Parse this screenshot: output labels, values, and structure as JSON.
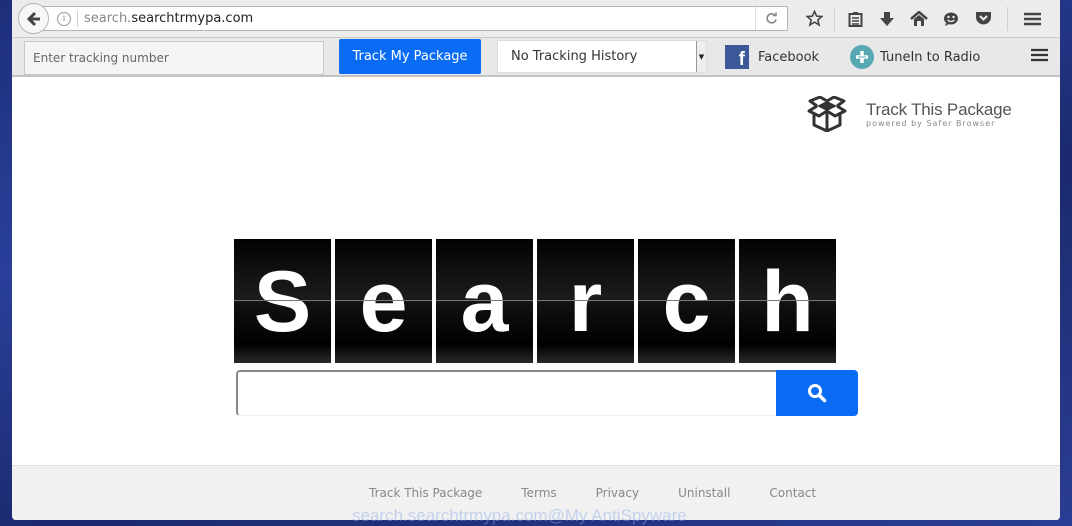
{
  "browser": {
    "url_prefix": "search.",
    "url_domain": "searchtrmypa.com",
    "icons": [
      "star-icon",
      "reading-list-icon",
      "download-icon",
      "home-icon",
      "hello-icon",
      "pocket-icon",
      "menu-icon"
    ]
  },
  "toolbar": {
    "tracking_placeholder": "Enter tracking number",
    "track_button": "Track My Package",
    "history_selected": "No Tracking History",
    "facebook_label": "Facebook",
    "tunein_label": "TuneIn to Radio"
  },
  "brand": {
    "title": "Track This Package",
    "subtitle": "powered by Safer Browser"
  },
  "search": {
    "tiles": [
      "S",
      "e",
      "a",
      "r",
      "c",
      "h"
    ],
    "input_value": "",
    "button_icon": "search-icon",
    "accent_color": "#0a6cf5"
  },
  "footer": {
    "links": [
      "Track This Package",
      "Terms",
      "Privacy",
      "Uninstall",
      "Contact"
    ]
  },
  "watermark": "search.searchtrmypa.com@My AntiSpyware"
}
